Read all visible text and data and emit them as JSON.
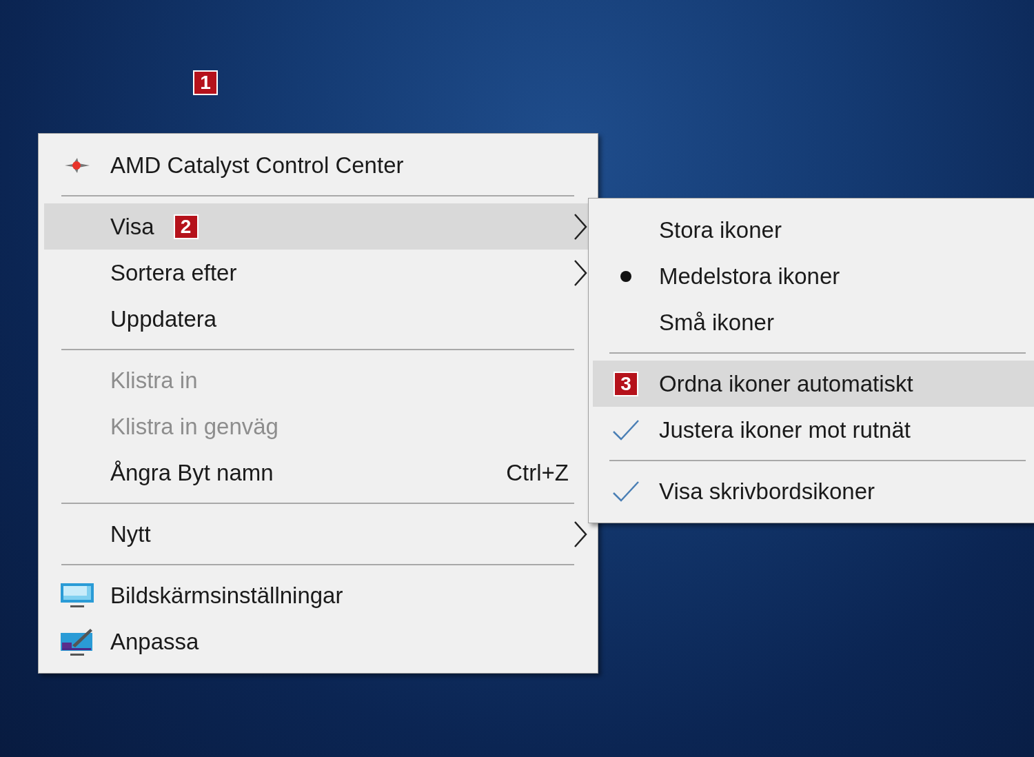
{
  "desktop": {
    "badge": "1"
  },
  "menu": {
    "items": [
      {
        "kind": "amd",
        "label": "AMD Catalyst Control Center",
        "selected": false,
        "disabled": false
      },
      {
        "kind": "separator"
      },
      {
        "kind": "item",
        "label": "Visa",
        "badge": "2",
        "submenu": true,
        "selected": true,
        "disabled": false
      },
      {
        "kind": "item",
        "label": "Sortera efter",
        "submenu": true,
        "selected": false,
        "disabled": false
      },
      {
        "kind": "item",
        "label": "Uppdatera",
        "selected": false,
        "disabled": false
      },
      {
        "kind": "separator"
      },
      {
        "kind": "item",
        "label": "Klistra in",
        "selected": false,
        "disabled": true
      },
      {
        "kind": "item",
        "label": "Klistra in genväg",
        "selected": false,
        "disabled": true
      },
      {
        "kind": "item",
        "label": "Ångra Byt namn",
        "shortcut": "Ctrl+Z",
        "selected": false,
        "disabled": false
      },
      {
        "kind": "separator"
      },
      {
        "kind": "item",
        "label": "Nytt",
        "submenu": true,
        "selected": false,
        "disabled": false
      },
      {
        "kind": "separator"
      },
      {
        "kind": "display",
        "label": "Bildskärmsinställningar",
        "selected": false,
        "disabled": false
      },
      {
        "kind": "personalize",
        "label": "Anpassa",
        "selected": false,
        "disabled": false
      }
    ]
  },
  "submenu": {
    "items": [
      {
        "kind": "item",
        "label": "Stora ikoner",
        "selected": false
      },
      {
        "kind": "bullet",
        "label": "Medelstora ikoner",
        "selected": false
      },
      {
        "kind": "item",
        "label": "Små ikoner",
        "selected": false
      },
      {
        "kind": "separator"
      },
      {
        "kind": "item",
        "label": "Ordna ikoner automatiskt",
        "badge": "3",
        "selected": true
      },
      {
        "kind": "check",
        "label": "Justera ikoner mot rutnät",
        "selected": false
      },
      {
        "kind": "separator"
      },
      {
        "kind": "check",
        "label": "Visa skrivbordsikoner",
        "selected": false
      }
    ]
  }
}
